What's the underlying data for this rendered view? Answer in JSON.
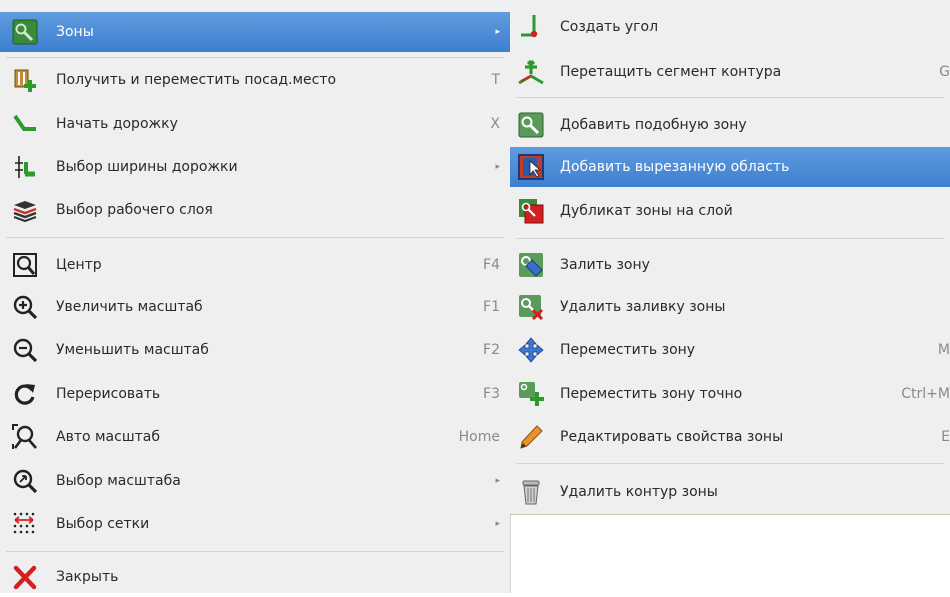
{
  "main_menu": {
    "items": [
      {
        "label": "Зоны",
        "shortcut": "",
        "submenu": true,
        "icon": "zone-icon"
      },
      {
        "label": "Получить и переместить посад.место",
        "shortcut": "T",
        "icon": "footprint-move-icon"
      },
      {
        "label": "Начать дорожку",
        "shortcut": "X",
        "icon": "track-icon"
      },
      {
        "label": "Выбор ширины дорожки",
        "shortcut": "",
        "submenu": true,
        "icon": "track-width-icon"
      },
      {
        "label": "Выбор рабочего слоя",
        "shortcut": "",
        "icon": "layers-icon"
      },
      {
        "label": "Центр",
        "shortcut": "F4",
        "icon": "zoom-center-icon"
      },
      {
        "label": "Увеличить масштаб",
        "shortcut": "F1",
        "icon": "zoom-in-icon"
      },
      {
        "label": "Уменьшить масштаб",
        "shortcut": "F2",
        "icon": "zoom-out-icon"
      },
      {
        "label": "Перерисовать",
        "shortcut": "F3",
        "icon": "redraw-icon"
      },
      {
        "label": "Авто масштаб",
        "shortcut": "Home",
        "icon": "zoom-fit-icon"
      },
      {
        "label": "Выбор масштаба",
        "shortcut": "",
        "submenu": true,
        "icon": "zoom-select-icon"
      },
      {
        "label": "Выбор сетки",
        "shortcut": "",
        "submenu": true,
        "icon": "grid-icon"
      },
      {
        "label": "Закрыть",
        "shortcut": "",
        "icon": "close-icon"
      }
    ],
    "arrow_glyph": "▸"
  },
  "sub_menu": {
    "items": [
      {
        "label": "Создать угол",
        "shortcut": "",
        "icon": "corner-icon"
      },
      {
        "label": "Перетащить сегмент контура",
        "shortcut": "G",
        "icon": "drag-segment-icon"
      },
      {
        "label": "Добавить подобную зону",
        "shortcut": "",
        "icon": "add-similar-zone-icon"
      },
      {
        "label": "Добавить вырезанную область",
        "shortcut": "",
        "icon": "add-cutout-icon"
      },
      {
        "label": "Дубликат зоны на слой",
        "shortcut": "",
        "icon": "duplicate-zone-icon"
      },
      {
        "label": "Залить зону",
        "shortcut": "",
        "icon": "fill-zone-icon"
      },
      {
        "label": "Удалить заливку зоны",
        "shortcut": "",
        "icon": "unfill-zone-icon"
      },
      {
        "label": "Переместить зону",
        "shortcut": "M",
        "icon": "move-icon"
      },
      {
        "label": "Переместить зону точно",
        "shortcut": "Ctrl+M",
        "icon": "move-exact-icon"
      },
      {
        "label": "Редактировать свойства зоны",
        "shortcut": "E",
        "icon": "pencil-icon"
      },
      {
        "label": "Удалить контур зоны",
        "shortcut": "",
        "icon": "trash-icon"
      }
    ]
  },
  "colors": {
    "highlight": "#3d7fcf",
    "menu_bg": "#efefef",
    "green": "#2e9a2e",
    "red": "#d42020"
  }
}
